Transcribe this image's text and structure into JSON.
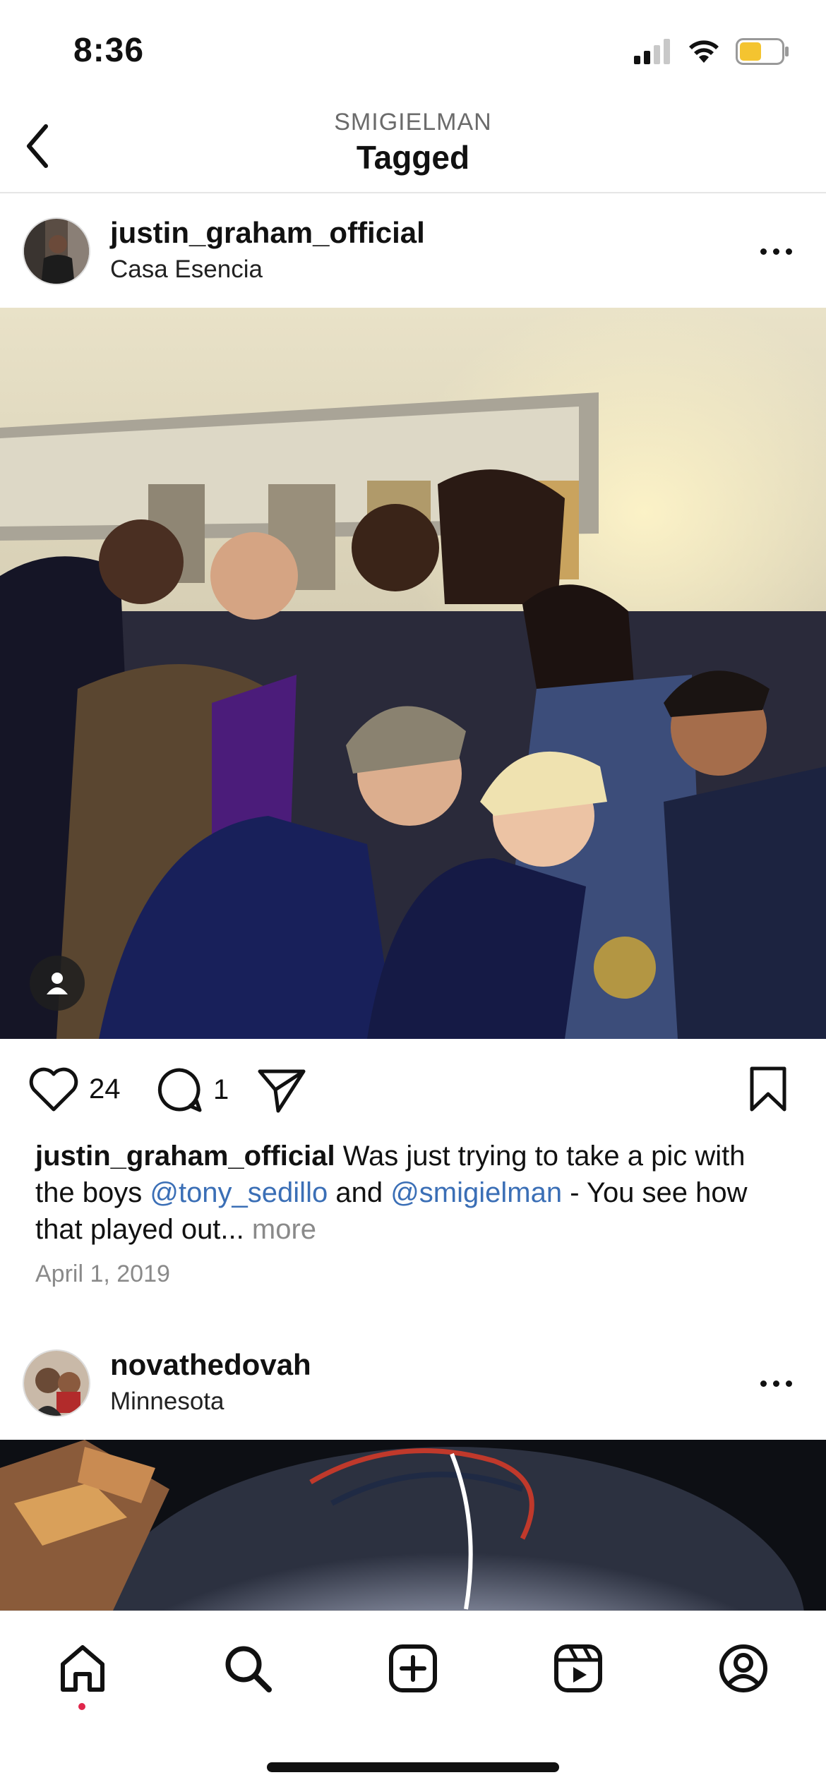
{
  "status_bar": {
    "time": "8:36",
    "signal": "signal-icon",
    "wifi": "wifi-icon",
    "battery": "battery-icon"
  },
  "header": {
    "subtitle": "SMIGIELMAN",
    "title": "Tagged",
    "back_icon": "chevron-left-icon"
  },
  "posts": [
    {
      "username": "justin_graham_official",
      "location": "Casa Esencia",
      "likes": "24",
      "comments": "1",
      "caption_text_1": "Was just trying to take a pic with the boys",
      "mention_1": "@tony_sedillo",
      "caption_and": "and",
      "mention_2": "@smigielman",
      "caption_text_2": "- You see how that played out...",
      "more_label": "more",
      "date": "April 1, 2019"
    },
    {
      "username": "novathedovah",
      "location": "Minnesota"
    }
  ],
  "tab_bar": {
    "items": [
      "home-icon",
      "search-icon",
      "create-icon",
      "reels-icon",
      "profile-icon"
    ]
  },
  "colors": {
    "mention": "#3b6fb6",
    "notification_dot": "#e0264b"
  }
}
